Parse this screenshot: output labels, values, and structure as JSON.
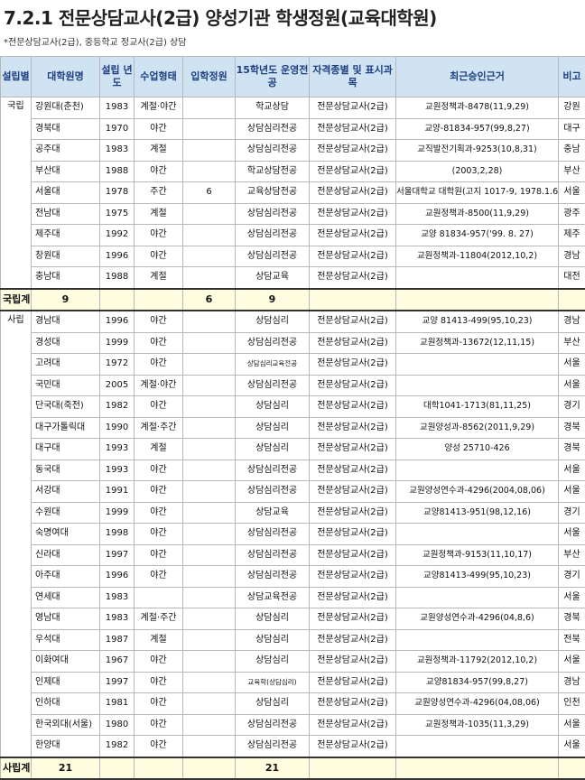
{
  "title": "7.2.1 전문상담교사(2급) 양성기관 학생정원(교육대학원)",
  "subtitle": "*전문상담교사(2급), 중등학교 정교사(2급) 상담",
  "headers": [
    "설립별",
    "대학원명",
    "설립 년도",
    "수업형태",
    "입학정원",
    "15학년도 운영전공",
    "자격종별 및 표시과목",
    "최근승인근거",
    "비고"
  ],
  "national": {
    "group": "국립",
    "rows": [
      {
        "univ": "강원대(춘천)",
        "year": "1983",
        "form": "계절·야간",
        "quota": "",
        "major": "학교상담",
        "cert": "전문상담교사(2급)",
        "approval": "교원정책과-8478(11,9,29)",
        "note": "강원"
      },
      {
        "univ": "경북대",
        "year": "1970",
        "form": "야간",
        "quota": "",
        "major": "상담심리전공",
        "cert": "전문상담교사(2급)",
        "approval": "교양-81834-957(99,8,27)",
        "note": "대구"
      },
      {
        "univ": "공주대",
        "year": "1983",
        "form": "계절",
        "quota": "",
        "major": "상담심리전공",
        "cert": "전문상담교사(2급)",
        "approval": "교직발전기획과-9253(10,8,31)",
        "note": "충남"
      },
      {
        "univ": "부산대",
        "year": "1988",
        "form": "야간",
        "quota": "",
        "major": "학교상담전공",
        "cert": "전문상담교사(2급)",
        "approval": "(2003,2,28)",
        "note": "부산"
      },
      {
        "univ": "서울대",
        "year": "1978",
        "form": "주간",
        "quota": "6",
        "major": "교육상담전공",
        "cert": "전문상담교사(2급)",
        "approval": "서울대학교 대학원(고지 1017-9, 1978.1.6.)",
        "note": "서울"
      },
      {
        "univ": "전남대",
        "year": "1975",
        "form": "계절",
        "quota": "",
        "major": "상담심리전공",
        "cert": "전문상담교사(2급)",
        "approval": "교원정책과-8500(11,9,29)",
        "note": "광주"
      },
      {
        "univ": "제주대",
        "year": "1992",
        "form": "야간",
        "quota": "",
        "major": "상담심리전공",
        "cert": "전문상담교사(2급)",
        "approval": "교양 81834-957('99. 8. 27)",
        "note": "제주"
      },
      {
        "univ": "창원대",
        "year": "1996",
        "form": "야간",
        "quota": "",
        "major": "상담심리전공",
        "cert": "전문상담교사(2급)",
        "approval": "교원정책과-11804(2012,10,2)",
        "note": "경남"
      },
      {
        "univ": "충남대",
        "year": "1988",
        "form": "계절",
        "quota": "",
        "major": "상담교육",
        "cert": "전문상담교사(2급)",
        "approval": "",
        "note": "대전"
      }
    ],
    "subtotal": {
      "label": "국립계",
      "count": "9",
      "quota": "6",
      "majors": "9"
    }
  },
  "private": {
    "group": "사립",
    "rows": [
      {
        "univ": "경남대",
        "year": "1996",
        "form": "야간",
        "quota": "",
        "major": "상담심리",
        "cert": "전문상담교사(2급)",
        "approval": "교양 81413-499(95,10,23)",
        "note": "경남"
      },
      {
        "univ": "경성대",
        "year": "1999",
        "form": "야간",
        "quota": "",
        "major": "상담심리전공",
        "cert": "전문상담교사(2급)",
        "approval": "교원정책과-13672(12,11,15)",
        "note": "부산"
      },
      {
        "univ": "고려대",
        "year": "1972",
        "form": "야간",
        "quota": "",
        "major": "상담심리교육전공",
        "cert": "전문상담교사(2급)",
        "approval": "",
        "note": "서울"
      },
      {
        "univ": "국민대",
        "year": "2005",
        "form": "계절·야간",
        "quota": "",
        "major": "상담심리전공",
        "cert": "전문상담교사(2급)",
        "approval": "",
        "note": "서울"
      },
      {
        "univ": "단국대(죽전)",
        "year": "1982",
        "form": "야간",
        "quota": "",
        "major": "상담심리",
        "cert": "전문상담교사(2급)",
        "approval": "대학1041-1713(81,11,25)",
        "note": "경기"
      },
      {
        "univ": "대구가톨릭대",
        "year": "1990",
        "form": "계절·주간",
        "quota": "",
        "major": "상담심리",
        "cert": "전문상담교사(2급)",
        "approval": "교원양성과-8562(2011,9,29)",
        "note": "경북"
      },
      {
        "univ": "대구대",
        "year": "1993",
        "form": "계절",
        "quota": "",
        "major": "상담심리",
        "cert": "전문상담교사(2급)",
        "approval": "양성 25710-426",
        "note": "경북"
      },
      {
        "univ": "동국대",
        "year": "1993",
        "form": "야간",
        "quota": "",
        "major": "상담심리전공",
        "cert": "전문상담교사(2급)",
        "approval": "",
        "note": "서울"
      },
      {
        "univ": "서강대",
        "year": "1991",
        "form": "야간",
        "quota": "",
        "major": "상담심리전공",
        "cert": "전문상담교사(2급)",
        "approval": "교원양성연수과-4296(2004,08,06)",
        "note": "서울"
      },
      {
        "univ": "수원대",
        "year": "1999",
        "form": "야간",
        "quota": "",
        "major": "상담교육",
        "cert": "전문상담교사(2급)",
        "approval": "교양81413-951(98,12,16)",
        "note": "경기"
      },
      {
        "univ": "숙명여대",
        "year": "1998",
        "form": "야간",
        "quota": "",
        "major": "상담심리전공",
        "cert": "전문상담교사(2급)",
        "approval": "",
        "note": "서울"
      },
      {
        "univ": "신라대",
        "year": "1997",
        "form": "야간",
        "quota": "",
        "major": "상담심리전공",
        "cert": "전문상담교사(2급)",
        "approval": "교원정책과-9153(11,10,17)",
        "note": "부산"
      },
      {
        "univ": "아주대",
        "year": "1996",
        "form": "야간",
        "quota": "",
        "major": "상담심리전공",
        "cert": "전문상담교사(2급)",
        "approval": "교양81413-499(95,10,23)",
        "note": "경기"
      },
      {
        "univ": "연세대",
        "year": "1983",
        "form": "",
        "quota": "",
        "major": "상담교육전공",
        "cert": "전문상담교사(2급)",
        "approval": "",
        "note": "서울"
      },
      {
        "univ": "영남대",
        "year": "1983",
        "form": "계절·주간",
        "quota": "",
        "major": "상담심리",
        "cert": "전문상담교사(2급)",
        "approval": "교원양성연수과-4296(04,8,6)",
        "note": "경북"
      },
      {
        "univ": "우석대",
        "year": "1987",
        "form": "계절",
        "quota": "",
        "major": "상담심리",
        "cert": "전문상담교사(2급)",
        "approval": "",
        "note": "전북"
      },
      {
        "univ": "이화여대",
        "year": "1967",
        "form": "야간",
        "quota": "",
        "major": "상담심리",
        "cert": "전문상담교사(2급)",
        "approval": "교원정책과-11792(2012,10,2)",
        "note": "서울"
      },
      {
        "univ": "인제대",
        "year": "1997",
        "form": "야간",
        "quota": "",
        "major": "교육학(상담심리)",
        "cert": "전문상담교사(2급)",
        "approval": "교양81834-957(99,8,27)",
        "note": "경남"
      },
      {
        "univ": "인하대",
        "year": "1981",
        "form": "야간",
        "quota": "",
        "major": "상담심리",
        "cert": "전문상담교사(2급)",
        "approval": "교원양성연수과-4296(04,08,06)",
        "note": "인천"
      },
      {
        "univ": "한국외대(서울)",
        "year": "1980",
        "form": "야간",
        "quota": "",
        "major": "상담심리전공",
        "cert": "전문상담교사(2급)",
        "approval": "교원정책과-1035(11,3,29)",
        "note": "서울"
      },
      {
        "univ": "한양대",
        "year": "1982",
        "form": "야간",
        "quota": "",
        "major": "상담심리전공",
        "cert": "전문상담교사(2급)",
        "approval": "",
        "note": "서울"
      }
    ],
    "subtotal": {
      "label": "사립계",
      "count": "21",
      "quota": "",
      "majors": "21"
    }
  }
}
